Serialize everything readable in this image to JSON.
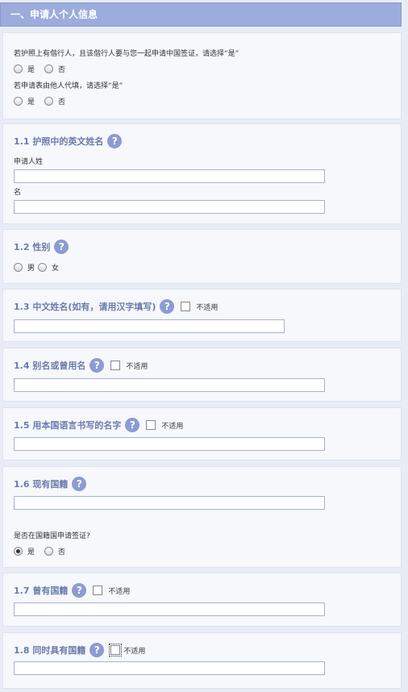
{
  "header": {
    "title": "一、申请人个人信息"
  },
  "intro": {
    "q1": "若护照上有偕行人，且该偕行人要与您一起申请中国签证，请选择“是”",
    "q2": "若申请表由他人代填，请选择“是”",
    "yes": "是",
    "no": "否"
  },
  "s11": {
    "title": "1.1 护照中的英文姓名",
    "surname_label": "申请人姓",
    "given_label": "名"
  },
  "s12": {
    "title": "1.2 性别",
    "male": "男",
    "female": "女"
  },
  "s13": {
    "title": "1.3 中文姓名(如有，请用汉字填写)",
    "na": "不适用"
  },
  "s14": {
    "title": "1.4 别名或曾用名",
    "na": "不适用"
  },
  "s15": {
    "title": "1.5 用本国语言书写的名字",
    "na": "不适用"
  },
  "s16": {
    "title": "1.6 现有国籍",
    "question": "是否在国籍国申请签证?",
    "yes": "是",
    "no": "否",
    "selected": "yes"
  },
  "s17": {
    "title": "1.7 曾有国籍",
    "na": "不适用"
  },
  "s18": {
    "title": "1.8 同时具有国籍",
    "na": "不适用"
  },
  "help_glyph": "?",
  "colors": {
    "header_bg": "#9cacdc",
    "title_text": "#6a7cae",
    "help_bg": "#8d9bd2",
    "page_bg": "#e8edf5"
  }
}
